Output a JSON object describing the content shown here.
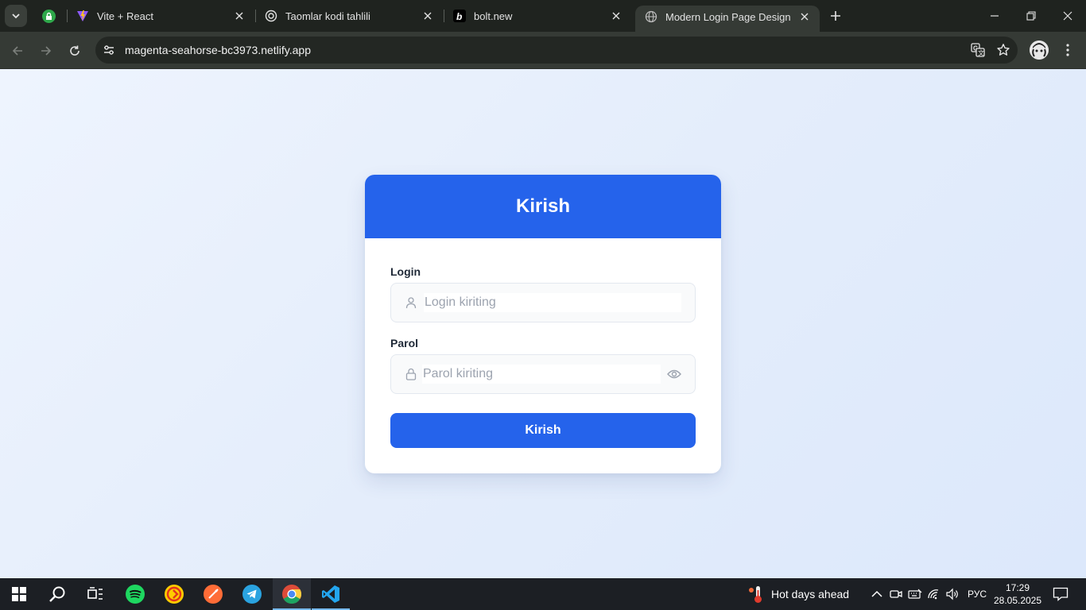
{
  "browser": {
    "tabs": [
      {
        "title": "",
        "icon": "green-lock-favicon-icon",
        "pinned": true
      },
      {
        "title": "Vite + React",
        "icon": "vite-icon"
      },
      {
        "title": "Taomlar kodi tahlili",
        "icon": "openai-icon"
      },
      {
        "title": "bolt.new",
        "icon": "bolt-icon"
      },
      {
        "title": "Modern Login Page Design",
        "icon": "globe-icon",
        "active": true
      }
    ],
    "url": "magenta-seahorse-bc3973.netlify.app"
  },
  "page": {
    "title": "Kirish",
    "login_label": "Login",
    "login_placeholder": "Login kiriting",
    "password_label": "Parol",
    "password_placeholder": "Parol kiriting",
    "submit_label": "Kirish"
  },
  "colors": {
    "primary": "#2563eb",
    "card": "#ffffff",
    "page_bg": "#e6eef9"
  },
  "taskbar": {
    "apps": [
      "windows-start-icon",
      "search-icon",
      "task-view-icon",
      "spotify-icon",
      "yandex-music-icon",
      "postman-icon",
      "telegram-icon",
      "chrome-icon",
      "vscode-icon"
    ],
    "weather_text": "Hot days ahead",
    "language": "РУС",
    "time": "17:29",
    "date": "28.05.2025"
  }
}
